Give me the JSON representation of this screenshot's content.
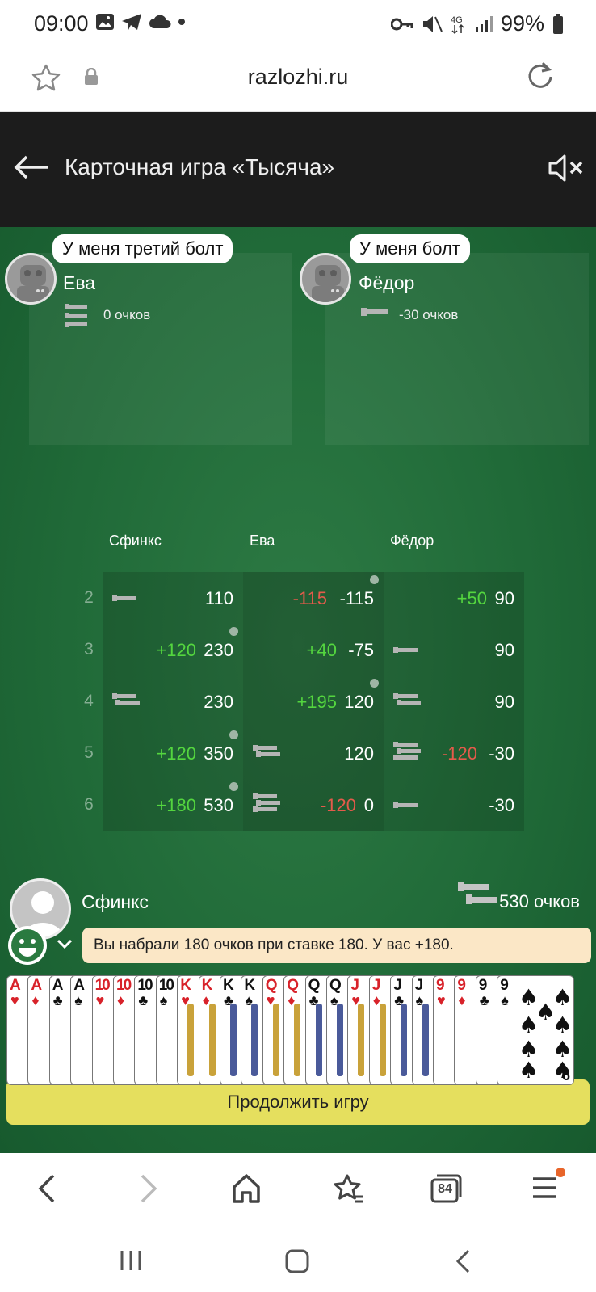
{
  "status_bar": {
    "time": "09:00",
    "battery": "99%",
    "icons": [
      "gallery-icon",
      "telegram-icon",
      "cloud-icon",
      "dot-icon",
      "key-icon",
      "mute-icon",
      "4g-icon",
      "signal-icon",
      "battery-icon"
    ]
  },
  "browser": {
    "url": "razlozhi.ru"
  },
  "app": {
    "title": "Карточная игра «Тысяча»"
  },
  "players": {
    "left": {
      "name": "Ева",
      "bubble": "У меня третий болт",
      "score": "0 очков"
    },
    "right": {
      "name": "Фёдор",
      "bubble": "У меня болт",
      "score": "-30 очков"
    },
    "me": {
      "name": "Сфинкс",
      "score": "530 очков"
    }
  },
  "score_table": {
    "headers": [
      "Сфинкс",
      "Ева",
      "Фёдор"
    ],
    "rows": [
      {
        "num": "2",
        "cells": [
          {
            "delta": "",
            "total": "110",
            "bolt": 1,
            "dot": false
          },
          {
            "delta": "-115",
            "total": "-115",
            "bolt": 0,
            "dot": true
          },
          {
            "delta": "+50",
            "total": "90",
            "bolt": 0,
            "dot": false
          }
        ]
      },
      {
        "num": "3",
        "cells": [
          {
            "delta": "+120",
            "total": "230",
            "bolt": 0,
            "dot": true
          },
          {
            "delta": "+40",
            "total": "-75",
            "bolt": 0,
            "dot": false
          },
          {
            "delta": "",
            "total": "90",
            "bolt": 1,
            "dot": false
          }
        ]
      },
      {
        "num": "4",
        "cells": [
          {
            "delta": "",
            "total": "230",
            "bolt": 2,
            "dot": false
          },
          {
            "delta": "+195",
            "total": "120",
            "bolt": 0,
            "dot": true
          },
          {
            "delta": "",
            "total": "90",
            "bolt": 2,
            "dot": false
          }
        ]
      },
      {
        "num": "5",
        "cells": [
          {
            "delta": "+120",
            "total": "350",
            "bolt": 0,
            "dot": true
          },
          {
            "delta": "",
            "total": "120",
            "bolt": 2,
            "dot": false
          },
          {
            "delta": "-120",
            "total": "-30",
            "bolt": 3,
            "dot": false
          }
        ]
      },
      {
        "num": "6",
        "cells": [
          {
            "delta": "+180",
            "total": "530",
            "bolt": 0,
            "dot": true
          },
          {
            "delta": "-120",
            "total": "0",
            "bolt": 3,
            "dot": false
          },
          {
            "delta": "",
            "total": "-30",
            "bolt": 1,
            "dot": false
          }
        ]
      }
    ]
  },
  "message": "Вы набрали 180 очков при ставке 180. У вас +180.",
  "hand": [
    {
      "rank": "A",
      "suit": "♥",
      "color": "red"
    },
    {
      "rank": "A",
      "suit": "♦",
      "color": "red"
    },
    {
      "rank": "A",
      "suit": "♣",
      "color": "blk"
    },
    {
      "rank": "A",
      "suit": "♠",
      "color": "blk"
    },
    {
      "rank": "10",
      "suit": "♥",
      "color": "red"
    },
    {
      "rank": "10",
      "suit": "♦",
      "color": "red"
    },
    {
      "rank": "10",
      "suit": "♣",
      "color": "blk"
    },
    {
      "rank": "10",
      "suit": "♠",
      "color": "blk"
    },
    {
      "rank": "K",
      "suit": "♥",
      "color": "red"
    },
    {
      "rank": "K",
      "suit": "♦",
      "color": "red"
    },
    {
      "rank": "K",
      "suit": "♣",
      "color": "blk"
    },
    {
      "rank": "K",
      "suit": "♠",
      "color": "blk"
    },
    {
      "rank": "Q",
      "suit": "♥",
      "color": "red"
    },
    {
      "rank": "Q",
      "suit": "♦",
      "color": "red"
    },
    {
      "rank": "Q",
      "suit": "♣",
      "color": "blk"
    },
    {
      "rank": "Q",
      "suit": "♠",
      "color": "blk"
    },
    {
      "rank": "J",
      "suit": "♥",
      "color": "red"
    },
    {
      "rank": "J",
      "suit": "♦",
      "color": "red"
    },
    {
      "rank": "J",
      "suit": "♣",
      "color": "blk"
    },
    {
      "rank": "J",
      "suit": "♠",
      "color": "blk"
    },
    {
      "rank": "9",
      "suit": "♥",
      "color": "red"
    },
    {
      "rank": "9",
      "suit": "♦",
      "color": "red"
    },
    {
      "rank": "9",
      "suit": "♣",
      "color": "blk"
    },
    {
      "rank": "9",
      "suit": "♠",
      "color": "blk"
    }
  ],
  "last_card_corner": "9",
  "continue_label": "Продолжить игру",
  "nav": {
    "tabs_count": "84"
  }
}
